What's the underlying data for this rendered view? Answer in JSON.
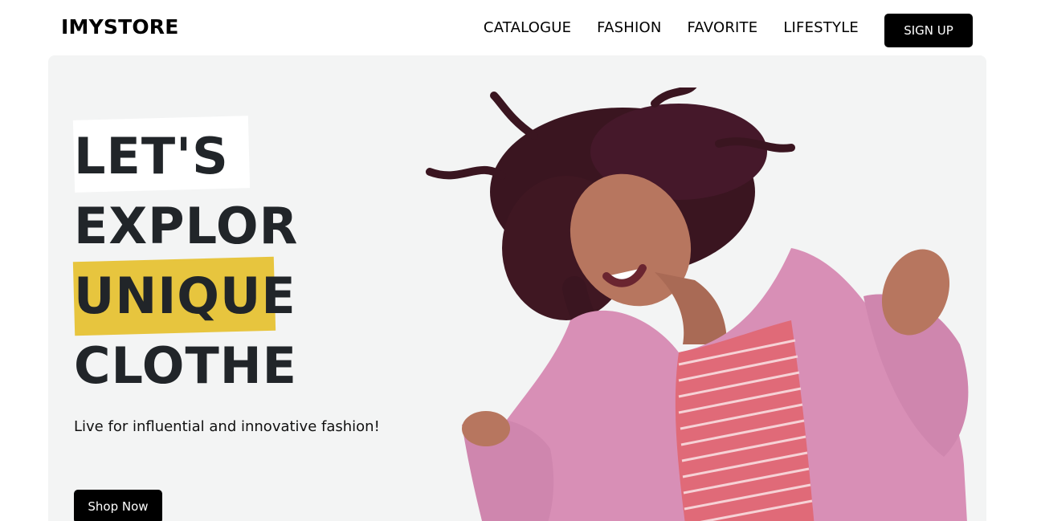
{
  "header": {
    "logo": "IMYSTORE",
    "nav": [
      "CATALOGUE",
      "FASHION",
      "FAVORITE",
      "LIFESTYLE"
    ],
    "signup_label": "SIGN UP"
  },
  "hero": {
    "lines": [
      "LET'S",
      "EXPLOR",
      "UNIQUE",
      "CLOTHE"
    ],
    "tagline": "Live for influential and innovative fashion!",
    "cta_label": "Shop Now"
  },
  "colors": {
    "accent_yellow": "#e7c53e",
    "hero_bg": "#f3f4f4",
    "button_bg": "#000000",
    "coat_pink": "#d88fb6",
    "dress_red": "#e06a78"
  }
}
